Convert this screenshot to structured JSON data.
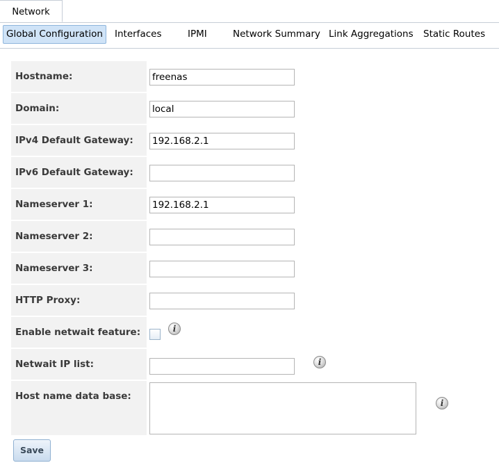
{
  "top_tabs": [
    {
      "label": "Network"
    }
  ],
  "sub_tabs": [
    {
      "label": "Global Configuration",
      "active": true
    },
    {
      "label": "Interfaces"
    },
    {
      "label": "IPMI"
    },
    {
      "label": "Network Summary"
    },
    {
      "label": "Link Aggregations"
    },
    {
      "label": "Static Routes"
    }
  ],
  "form": {
    "hostname": {
      "label": "Hostname:",
      "value": "freenas"
    },
    "domain": {
      "label": "Domain:",
      "value": "local"
    },
    "ipv4_gateway": {
      "label": "IPv4 Default Gateway:",
      "value": "192.168.2.1"
    },
    "ipv6_gateway": {
      "label": "IPv6 Default Gateway:",
      "value": ""
    },
    "nameserver1": {
      "label": "Nameserver 1:",
      "value": "192.168.2.1"
    },
    "nameserver2": {
      "label": "Nameserver 2:",
      "value": ""
    },
    "nameserver3": {
      "label": "Nameserver 3:",
      "value": ""
    },
    "http_proxy": {
      "label": "HTTP Proxy:",
      "value": ""
    },
    "netwait_enabled": {
      "label": "Enable netwait feature:",
      "checked": false
    },
    "netwait_ip_list": {
      "label": "Netwait IP list:",
      "value": ""
    },
    "host_name_db": {
      "label": "Host name data base:",
      "value": ""
    }
  },
  "icons": {
    "info": "i"
  },
  "buttons": {
    "save_label": "Save"
  }
}
